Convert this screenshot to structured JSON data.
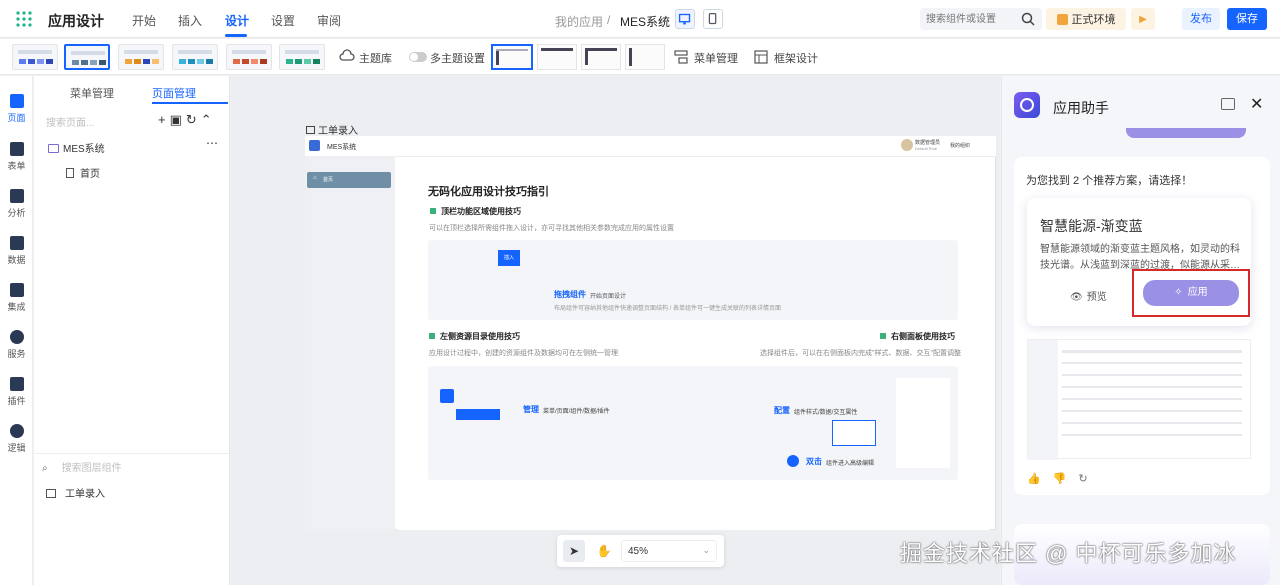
{
  "header": {
    "app_name": "应用设计",
    "nav": [
      "开始",
      "插入",
      "设计",
      "设置",
      "审阅"
    ],
    "active_nav": "设计",
    "breadcrumb": [
      "我的应用",
      "/",
      "MES系统"
    ],
    "search_placeholder": "搜索组件或设置",
    "env_label": "正式环境",
    "publish_label": "发布",
    "save_label": "保存"
  },
  "themebar": {
    "theme_library": "主题库",
    "multi_theme": "多主题设置",
    "menu_manage": "菜单管理",
    "frame_design": "框架设计"
  },
  "rail": {
    "items": [
      "页面",
      "表单",
      "分析",
      "数据",
      "集成",
      "服务",
      "插件",
      "逻辑"
    ]
  },
  "left_panel": {
    "tabs": [
      "菜单管理",
      "页面管理"
    ],
    "active_tab": "页面管理",
    "search_placeholder": "搜索页面...",
    "tree": {
      "app": "MES系统",
      "page": "首页"
    },
    "component_search_placeholder": "搜索图层组件",
    "component_item": "工单录入"
  },
  "canvas": {
    "page_label": "工单录入",
    "app_title": "MES系统",
    "user_name": "数据管理员",
    "user_sub": "Default Role",
    "my_org": "我的组织",
    "side_item": "首页",
    "doc_title": "无码化应用设计技巧指引",
    "sec1_title": "顶栏功能区域使用技巧",
    "sec1_desc": "可以在顶栏选择所需组件拖入设计，亦可寻找其他相关参数完成应用的属性设置",
    "insert_label": "插入",
    "drag_title": "拖拽组件",
    "drag_sub": "开始页面设计",
    "drag_desc": "布局组件可容纳其他组件快速调整页面结构 / 表单组件可一键生成关联的列表详情页面",
    "sec2_title": "左侧资源目录使用技巧",
    "sec2_desc": "应用设计过程中，创建的资源组件及数据均可在左侧统一管理",
    "manage_title": "管理",
    "manage_sub": "菜单/页面/组件/数据/插件",
    "sec3_title": "右侧面板使用技巧",
    "sec3_desc": "选择组件后，可以在右侧面板内完成\"样式、数据、交互\"配置调整",
    "config_title": "配置",
    "config_sub": "组件样式/数据/交互属性",
    "dbl_title": "双击",
    "dbl_sub": "组件进入高级编辑"
  },
  "canvas_tools": {
    "zoom": "45%"
  },
  "assistant": {
    "title": "应用助手",
    "found_text": "为您找到 2 个推荐方案，请选择！",
    "card_title": "智慧能源-渐变蓝",
    "card_desc": "智慧能源领域的渐变蓝主题风格，如灵动的科技光谱。从浅蓝到深蓝的过渡，似能源从采…",
    "preview_label": "预览",
    "apply_label": "应用"
  },
  "watermark": "掘金技术社区 @ 中杯可乐多加冰",
  "colors": {
    "accent": "#1664ff",
    "apply": "#9a91e6",
    "highlight": "#d62a2a"
  }
}
